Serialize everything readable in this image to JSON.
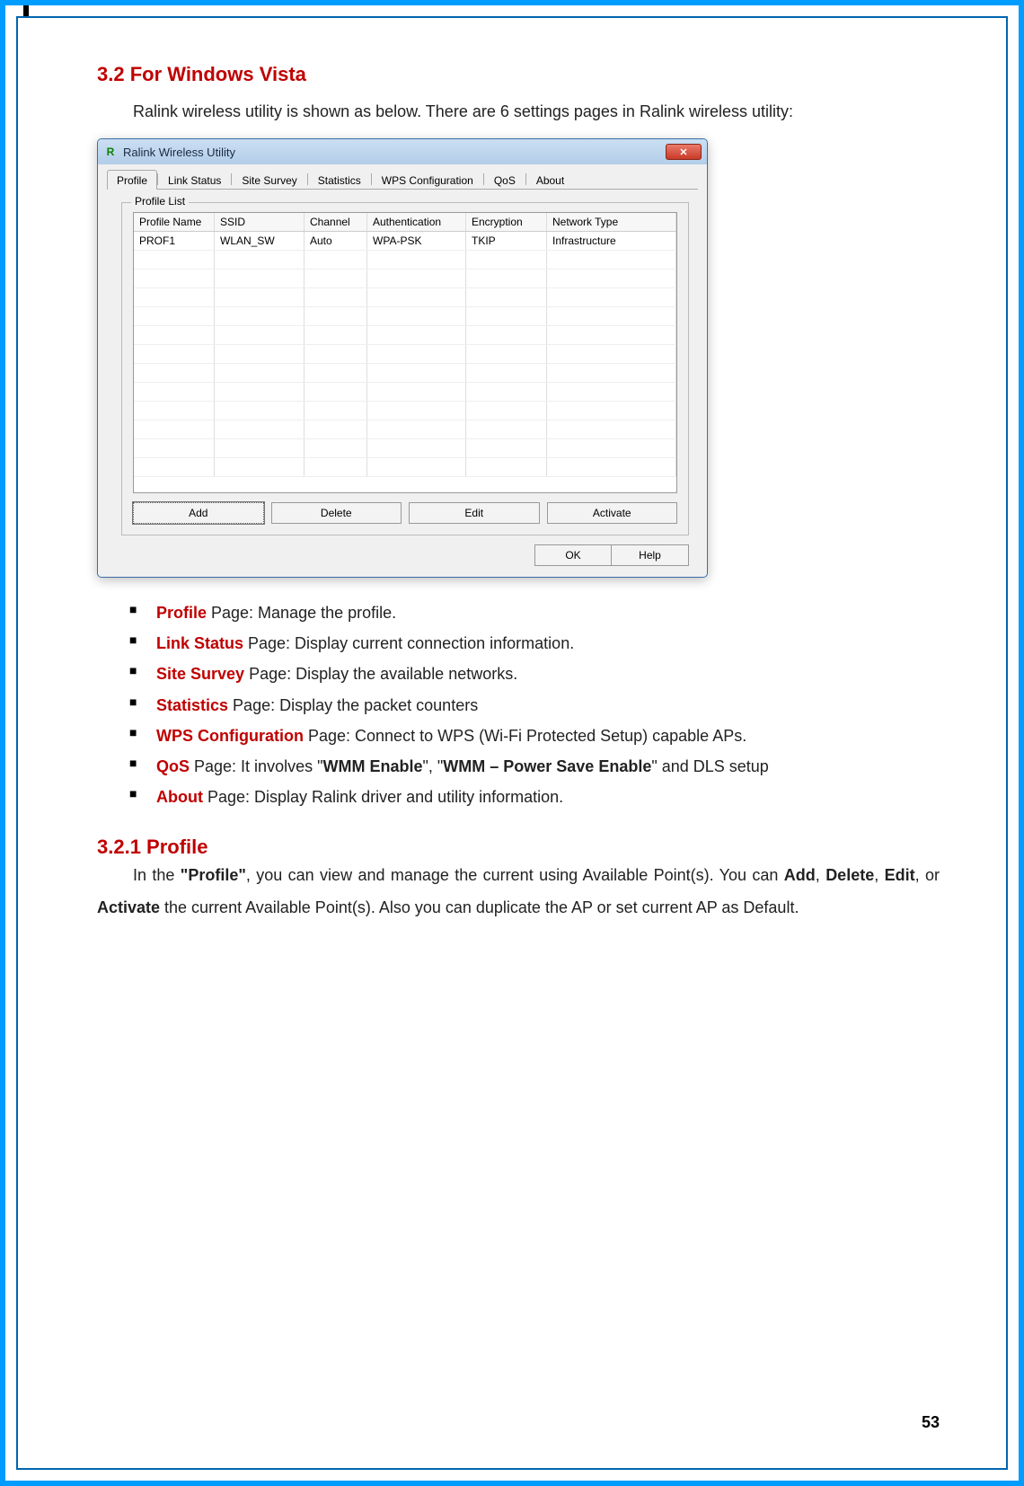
{
  "heading_1": "3.2 For Windows Vista",
  "intro": "Ralink wireless utility is shown as below. There are 6 settings pages in Ralink wireless utility:",
  "window": {
    "title": "Ralink Wireless Utility",
    "close_glyph": "✕",
    "tabs": [
      "Profile",
      "Link Status",
      "Site Survey",
      "Statistics",
      "WPS Configuration",
      "QoS",
      "About"
    ],
    "active_tab": 0,
    "groupbox_legend": "Profile List",
    "columns": [
      "Profile Name",
      "SSID",
      "Channel",
      "Authentication",
      "Encryption",
      "Network Type"
    ],
    "rows": [
      {
        "profile": "PROF1",
        "ssid": "WLAN_SW",
        "channel": "Auto",
        "auth": "WPA-PSK",
        "enc": "TKIP",
        "ntype": "Infrastructure"
      }
    ],
    "buttons": {
      "add": "Add",
      "delete": "Delete",
      "edit": "Edit",
      "activate": "Activate"
    },
    "ok": "OK",
    "help": "Help"
  },
  "bullets": [
    {
      "accent": "Profile",
      "rest": " Page: Manage the profile."
    },
    {
      "accent": "Link Status",
      "rest": " Page: Display current connection information."
    },
    {
      "accent": "Site Survey",
      "rest": " Page: Display the available networks."
    },
    {
      "accent": "Statistics",
      "rest": " Page: Display the packet counters"
    },
    {
      "accent": "WPS Configuration",
      "rest": " Page: Connect to WPS (Wi-Fi Protected Setup) capable APs."
    },
    {
      "accent": "QoS",
      "rest_before": " Page: It involves \"",
      "bold1": "WMM Enable",
      "mid": "\", \"",
      "bold2": "WMM – Power Save Enable",
      "rest_after": "\" and DLS setup"
    },
    {
      "accent": "About",
      "rest": " Page: Display Ralink driver and utility information."
    }
  ],
  "heading_2": "3.2.1  Profile",
  "profile_para": {
    "p1": "In the ",
    "b1": "\"Profile\"",
    "p2": ", you can view and manage the current using Available Point(s). You can ",
    "b2": "Add",
    "c1": ", ",
    "b3": "Delete",
    "c2": ", ",
    "b4": "Edit",
    "c3": ", or ",
    "b5": "Activate",
    "p3": " the current Available Point(s). Also you can duplicate the AP or set current AP as Default."
  },
  "page_number": "53"
}
